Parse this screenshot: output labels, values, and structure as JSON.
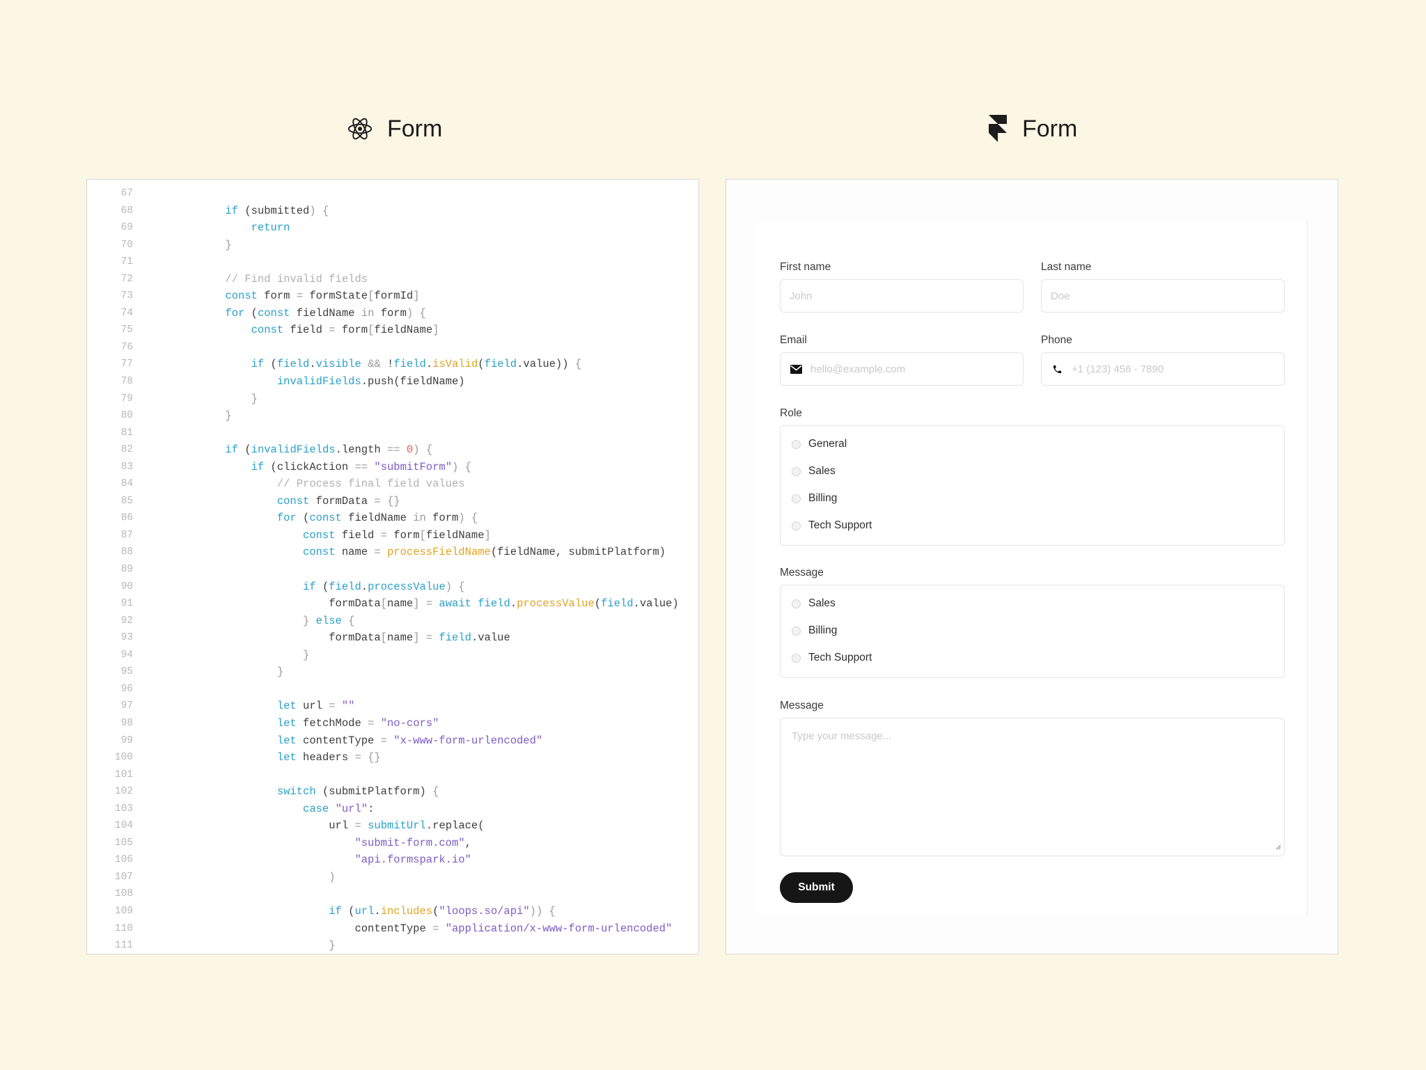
{
  "left_header": {
    "title": "Form",
    "icon": "react-icon"
  },
  "right_header": {
    "title": "Form",
    "icon": "framer-icon"
  },
  "colors": {
    "background": "#fcf6e4",
    "keyword": "#2aa0c9",
    "function": "#e0a324",
    "string": "#7c5cc4",
    "number": "#e55d43",
    "comment": "#b0b0b0",
    "submit": "#161616"
  },
  "code": {
    "lines": [
      {
        "n": "67",
        "tokens": []
      },
      {
        "n": "68",
        "tokens": [
          [
            "        ",
            ""
          ],
          [
            "if",
            "kw"
          ],
          [
            " (",
            ""
          ],
          [
            "submitted",
            ""
          ],
          [
            ") {",
            "pun"
          ]
        ]
      },
      {
        "n": "69",
        "tokens": [
          [
            "            ",
            ""
          ],
          [
            "return",
            "kw"
          ]
        ]
      },
      {
        "n": "70",
        "tokens": [
          [
            "        ",
            ""
          ],
          [
            "}",
            "pun"
          ]
        ]
      },
      {
        "n": "71",
        "tokens": []
      },
      {
        "n": "72",
        "tokens": [
          [
            "        ",
            ""
          ],
          [
            "// Find invalid fields",
            "com"
          ]
        ]
      },
      {
        "n": "73",
        "tokens": [
          [
            "        ",
            ""
          ],
          [
            "const",
            "kw"
          ],
          [
            " form ",
            ""
          ],
          [
            "=",
            "pun"
          ],
          [
            " formState",
            ""
          ],
          [
            "[",
            "pun"
          ],
          [
            "formId",
            ""
          ],
          [
            "]",
            "pun"
          ]
        ]
      },
      {
        "n": "74",
        "tokens": [
          [
            "        ",
            ""
          ],
          [
            "for",
            "kw"
          ],
          [
            " (",
            ""
          ],
          [
            "const",
            "kw"
          ],
          [
            " fieldName ",
            ""
          ],
          [
            "in",
            "pun"
          ],
          [
            " form",
            ""
          ],
          [
            ") {",
            "pun"
          ]
        ]
      },
      {
        "n": "75",
        "tokens": [
          [
            "            ",
            ""
          ],
          [
            "const",
            "kw"
          ],
          [
            " field ",
            ""
          ],
          [
            "=",
            "pun"
          ],
          [
            " form",
            ""
          ],
          [
            "[",
            "pun"
          ],
          [
            "fieldName",
            ""
          ],
          [
            "]",
            "pun"
          ]
        ]
      },
      {
        "n": "76",
        "tokens": []
      },
      {
        "n": "77",
        "tokens": [
          [
            "            ",
            ""
          ],
          [
            "if",
            "kw"
          ],
          [
            " (",
            ""
          ],
          [
            "field",
            "var"
          ],
          [
            ".",
            ""
          ],
          [
            "visible",
            "var"
          ],
          [
            " && ",
            "pun"
          ],
          [
            "!",
            ""
          ],
          [
            "field",
            "var"
          ],
          [
            ".",
            ""
          ],
          [
            "isValid",
            "fn"
          ],
          [
            "(",
            ""
          ],
          [
            "field",
            "var"
          ],
          [
            ".value)) ",
            ""
          ],
          [
            "{",
            "pun"
          ]
        ]
      },
      {
        "n": "78",
        "tokens": [
          [
            "                ",
            ""
          ],
          [
            "invalidFields",
            "var"
          ],
          [
            ".push(fieldName)",
            ""
          ]
        ]
      },
      {
        "n": "79",
        "tokens": [
          [
            "            ",
            ""
          ],
          [
            "}",
            "pun"
          ]
        ]
      },
      {
        "n": "80",
        "tokens": [
          [
            "        ",
            ""
          ],
          [
            "}",
            "pun"
          ]
        ]
      },
      {
        "n": "81",
        "tokens": []
      },
      {
        "n": "82",
        "tokens": [
          [
            "        ",
            ""
          ],
          [
            "if",
            "kw"
          ],
          [
            " (",
            ""
          ],
          [
            "invalidFields",
            "var"
          ],
          [
            ".length ",
            ""
          ],
          [
            "==",
            "pun"
          ],
          [
            " ",
            ""
          ],
          [
            "0",
            "num"
          ],
          [
            ") {",
            "pun"
          ]
        ]
      },
      {
        "n": "83",
        "tokens": [
          [
            "            ",
            ""
          ],
          [
            "if",
            "kw"
          ],
          [
            " (clickAction ",
            ""
          ],
          [
            "==",
            "pun"
          ],
          [
            " ",
            ""
          ],
          [
            "\"submitForm\"",
            "str"
          ],
          [
            ") {",
            "pun"
          ]
        ]
      },
      {
        "n": "84",
        "tokens": [
          [
            "                ",
            ""
          ],
          [
            "// Process final field values",
            "com"
          ]
        ]
      },
      {
        "n": "85",
        "tokens": [
          [
            "                ",
            ""
          ],
          [
            "const",
            "kw"
          ],
          [
            " formData ",
            ""
          ],
          [
            "= {}",
            "pun"
          ]
        ]
      },
      {
        "n": "86",
        "tokens": [
          [
            "                ",
            ""
          ],
          [
            "for",
            "kw"
          ],
          [
            " (",
            ""
          ],
          [
            "const",
            "kw"
          ],
          [
            " fieldName ",
            ""
          ],
          [
            "in",
            "pun"
          ],
          [
            " form",
            ""
          ],
          [
            ") {",
            "pun"
          ]
        ]
      },
      {
        "n": "87",
        "tokens": [
          [
            "                    ",
            ""
          ],
          [
            "const",
            "kw"
          ],
          [
            " field ",
            ""
          ],
          [
            "=",
            "pun"
          ],
          [
            " form",
            ""
          ],
          [
            "[",
            "pun"
          ],
          [
            "fieldName",
            ""
          ],
          [
            "]",
            "pun"
          ]
        ]
      },
      {
        "n": "88",
        "tokens": [
          [
            "                    ",
            ""
          ],
          [
            "const",
            "kw"
          ],
          [
            " name ",
            ""
          ],
          [
            "=",
            "pun"
          ],
          [
            " ",
            ""
          ],
          [
            "processFieldName",
            "fn"
          ],
          [
            "(fieldName, submitPlatform)",
            ""
          ]
        ]
      },
      {
        "n": "89",
        "tokens": []
      },
      {
        "n": "90",
        "tokens": [
          [
            "                    ",
            ""
          ],
          [
            "if",
            "kw"
          ],
          [
            " (",
            ""
          ],
          [
            "field",
            "var"
          ],
          [
            ".",
            ""
          ],
          [
            "processValue",
            "var"
          ],
          [
            ") {",
            "pun"
          ]
        ]
      },
      {
        "n": "91",
        "tokens": [
          [
            "                        ",
            ""
          ],
          [
            "formData",
            ""
          ],
          [
            "[",
            "pun"
          ],
          [
            "name",
            ""
          ],
          [
            "]",
            "pun"
          ],
          [
            " = ",
            "pun"
          ],
          [
            "await",
            "kw"
          ],
          [
            " ",
            ""
          ],
          [
            "field",
            "var"
          ],
          [
            ".",
            ""
          ],
          [
            "processValue",
            "fn"
          ],
          [
            "(",
            ""
          ],
          [
            "field",
            "var"
          ],
          [
            ".value)",
            ""
          ]
        ]
      },
      {
        "n": "92",
        "tokens": [
          [
            "                    ",
            ""
          ],
          [
            "} ",
            "pun"
          ],
          [
            "else",
            "kw"
          ],
          [
            " {",
            "pun"
          ]
        ]
      },
      {
        "n": "93",
        "tokens": [
          [
            "                        ",
            ""
          ],
          [
            "formData",
            ""
          ],
          [
            "[",
            "pun"
          ],
          [
            "name",
            ""
          ],
          [
            "]",
            "pun"
          ],
          [
            " = ",
            "pun"
          ],
          [
            "field",
            "var"
          ],
          [
            ".value",
            ""
          ]
        ]
      },
      {
        "n": "94",
        "tokens": [
          [
            "                    ",
            ""
          ],
          [
            "}",
            "pun"
          ]
        ]
      },
      {
        "n": "95",
        "tokens": [
          [
            "                ",
            ""
          ],
          [
            "}",
            "pun"
          ]
        ]
      },
      {
        "n": "96",
        "tokens": []
      },
      {
        "n": "97",
        "tokens": [
          [
            "                ",
            ""
          ],
          [
            "let",
            "kw"
          ],
          [
            " url ",
            ""
          ],
          [
            "=",
            "pun"
          ],
          [
            " ",
            ""
          ],
          [
            "\"\"",
            "str"
          ]
        ]
      },
      {
        "n": "98",
        "tokens": [
          [
            "                ",
            ""
          ],
          [
            "let",
            "kw"
          ],
          [
            " fetchMode ",
            ""
          ],
          [
            "=",
            "pun"
          ],
          [
            " ",
            ""
          ],
          [
            "\"no-cors\"",
            "str"
          ]
        ]
      },
      {
        "n": "99",
        "tokens": [
          [
            "                ",
            ""
          ],
          [
            "let",
            "kw"
          ],
          [
            " contentType ",
            ""
          ],
          [
            "=",
            "pun"
          ],
          [
            " ",
            ""
          ],
          [
            "\"x-www-form-urlencoded\"",
            "str"
          ]
        ]
      },
      {
        "n": "100",
        "tokens": [
          [
            "                ",
            ""
          ],
          [
            "let",
            "kw"
          ],
          [
            " headers ",
            ""
          ],
          [
            "= {}",
            "pun"
          ]
        ]
      },
      {
        "n": "101",
        "tokens": []
      },
      {
        "n": "102",
        "tokens": [
          [
            "                ",
            ""
          ],
          [
            "switch",
            "kw"
          ],
          [
            " (submitPlatform) ",
            ""
          ],
          [
            "{",
            "pun"
          ]
        ]
      },
      {
        "n": "103",
        "tokens": [
          [
            "                    ",
            ""
          ],
          [
            "case",
            "kw"
          ],
          [
            " ",
            ""
          ],
          [
            "\"url\"",
            "str"
          ],
          [
            ":",
            ""
          ]
        ]
      },
      {
        "n": "104",
        "tokens": [
          [
            "                        ",
            ""
          ],
          [
            "url ",
            ""
          ],
          [
            "=",
            "pun"
          ],
          [
            " ",
            ""
          ],
          [
            "submitUrl",
            "var"
          ],
          [
            ".replace(",
            ""
          ]
        ]
      },
      {
        "n": "105",
        "tokens": [
          [
            "                            ",
            ""
          ],
          [
            "\"submit-form.com\"",
            "str"
          ],
          [
            ",",
            ""
          ]
        ]
      },
      {
        "n": "106",
        "tokens": [
          [
            "                            ",
            ""
          ],
          [
            "\"api.formspark.io\"",
            "str"
          ]
        ]
      },
      {
        "n": "107",
        "tokens": [
          [
            "                        ",
            ""
          ],
          [
            ")",
            "pun"
          ]
        ]
      },
      {
        "n": "108",
        "tokens": []
      },
      {
        "n": "109",
        "tokens": [
          [
            "                        ",
            ""
          ],
          [
            "if",
            "kw"
          ],
          [
            " (",
            ""
          ],
          [
            "url",
            "var"
          ],
          [
            ".",
            ""
          ],
          [
            "includes",
            "fn"
          ],
          [
            "(",
            ""
          ],
          [
            "\"loops.so/api\"",
            "str"
          ],
          [
            ")) {",
            "pun"
          ]
        ]
      },
      {
        "n": "110",
        "tokens": [
          [
            "                            ",
            ""
          ],
          [
            "contentType ",
            ""
          ],
          [
            "=",
            "pun"
          ],
          [
            " ",
            ""
          ],
          [
            "\"application/x-www-form-urlencoded\"",
            "str"
          ]
        ]
      },
      {
        "n": "111",
        "tokens": [
          [
            "                        ",
            ""
          ],
          [
            "}",
            "pun"
          ]
        ]
      }
    ]
  },
  "form": {
    "first_name": {
      "label": "First name",
      "placeholder": "John"
    },
    "last_name": {
      "label": "Last name",
      "placeholder": "Doe"
    },
    "email": {
      "label": "Email",
      "placeholder": "hello@example.com",
      "icon": "mail-icon"
    },
    "phone": {
      "label": "Phone",
      "placeholder": "+1 (123) 456 - 7890",
      "icon": "phone-icon"
    },
    "role": {
      "label": "Role",
      "options": [
        "General",
        "Sales",
        "Billing",
        "Tech Support"
      ]
    },
    "message_choice": {
      "label": "Message",
      "options": [
        "Sales",
        "Billing",
        "Tech Support"
      ]
    },
    "message": {
      "label": "Message",
      "placeholder": "Type your message..."
    },
    "submit_label": "Submit"
  }
}
